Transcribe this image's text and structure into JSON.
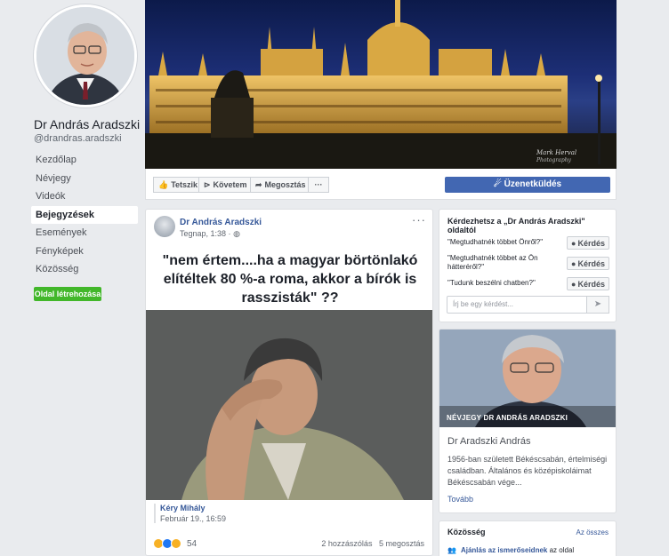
{
  "page": {
    "name": "Dr András Aradszki",
    "handle": "@drandras.aradszki"
  },
  "nav": {
    "items": [
      {
        "label": "Kezdőlap",
        "active": false
      },
      {
        "label": "Névjegy",
        "active": false
      },
      {
        "label": "Videók",
        "active": false
      },
      {
        "label": "Bejegyzések",
        "active": true
      },
      {
        "label": "Események",
        "active": false
      },
      {
        "label": "Fényképek",
        "active": false
      },
      {
        "label": "Közösség",
        "active": false
      }
    ],
    "create_label": "Oldal létrehozása"
  },
  "cover": {
    "watermark_line1": "Mark Herval",
    "watermark_line2": "Photography"
  },
  "actions": {
    "like": "Tetszik",
    "follow": "Követem",
    "share": "Megosztás",
    "more": "···",
    "message": "Üzenetküldés"
  },
  "post": {
    "author": "Dr András Aradszki",
    "time": "Tegnap, 1:38 ·",
    "quote": "\"nem értem....ha a magyar börtönlakó elítéltek 80 %-a roma, akkor a bírók is rasszisták\" ??",
    "shared_author": "Kéry Mihály",
    "shared_date": "Február 19., 16:59",
    "reaction_count": "54",
    "comments": "2 hozzászólás",
    "shares": "5 megosztás"
  },
  "questions": {
    "title": "Kérdezhetsz a „Dr András Aradszki\" oldaltól",
    "items": [
      {
        "text": "\"Megtudhatnék többet Önről?\"",
        "button": "Kérdés"
      },
      {
        "text": "\"Megtudhatnék többet az Ön hátteréről?\"",
        "button": "Kérdés"
      },
      {
        "text": "\"Tudunk beszélni chatben?\"",
        "button": "Kérdés"
      }
    ],
    "placeholder": "Írj be egy kérdést..."
  },
  "bio": {
    "image_label": "NÉVJEGY DR ANDRÁS ARADSZKI",
    "name": "Dr Aradszki András",
    "text": "1956-ban született Békéscsabán, értelmiségi családban. Általános és középiskoláimat Békéscsabán vége...",
    "more": "Tovább"
  },
  "community": {
    "title": "Közösség",
    "see_all": "Az összes",
    "invite_bold": "Ajánlás az ismerőseidnek",
    "invite_rest": "az oldal"
  },
  "colors": {
    "accent": "#4267b2",
    "link": "#365899",
    "green": "#42b72a",
    "background": "#e9ebee"
  }
}
